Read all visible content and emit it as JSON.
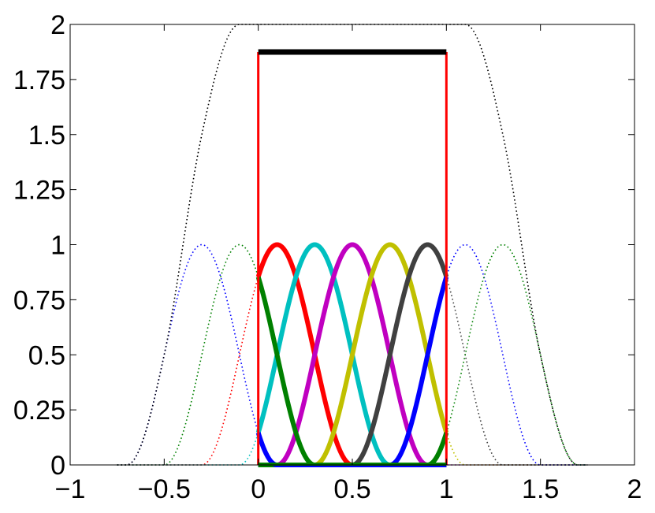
{
  "chart_data": {
    "type": "line",
    "title": "",
    "xlabel": "",
    "ylabel": "",
    "xlim": [
      -1,
      2
    ],
    "ylim": [
      0,
      2
    ],
    "grid": false,
    "legend": "none",
    "x_ticks": [
      -1,
      -0.5,
      0,
      0.5,
      1,
      1.5,
      2
    ],
    "x_tick_labels": [
      "−1",
      "−0.5",
      "0",
      "0.5",
      "1",
      "1.5",
      "2"
    ],
    "y_ticks": [
      0,
      0.25,
      0.5,
      0.75,
      1,
      1.25,
      1.5,
      1.75,
      2
    ],
    "y_tick_labels": [
      "0",
      "0.25",
      "0.5",
      "0.75",
      "1",
      "1.25",
      "1.5",
      "1.75",
      "2"
    ],
    "basis_width": 0.4,
    "series": [
      {
        "center": -0.3,
        "color": "#0000ff",
        "style": "dotted",
        "visible_range": [
          -0.75,
          1
        ]
      },
      {
        "center": -0.1,
        "color": "#008000",
        "style": "dotted",
        "visible_range": [
          -0.75,
          1
        ]
      },
      {
        "center": 0.1,
        "color": "#ff0000",
        "style": "dotted",
        "visible_range": [
          -0.75,
          1
        ]
      },
      {
        "center": 0.3,
        "color": "#00c0c0",
        "style": "dotted",
        "visible_range": [
          -0.75,
          1
        ]
      },
      {
        "center": 0.5,
        "color": "#c000c0",
        "style": "dotted",
        "visible_range": [
          0,
          1.75
        ]
      },
      {
        "center": 0.7,
        "color": "#c0c000",
        "style": "dotted",
        "visible_range": [
          0,
          1.75
        ]
      },
      {
        "center": 0.9,
        "color": "#404040",
        "style": "dotted",
        "visible_range": [
          0,
          1.75
        ]
      },
      {
        "center": 1.1,
        "color": "#0000ff",
        "style": "dotted",
        "visible_range": [
          0,
          1.75
        ]
      },
      {
        "center": 1.3,
        "color": "#008000",
        "style": "dotted",
        "visible_range": [
          0,
          1.75
        ]
      },
      {
        "center": 0.1,
        "color": "#ff0000",
        "style": "solid",
        "visible_range": [
          0,
          1
        ]
      },
      {
        "center": 0.3,
        "color": "#00c0c0",
        "style": "solid",
        "visible_range": [
          0,
          1
        ]
      },
      {
        "center": 0.5,
        "color": "#c000c0",
        "style": "solid",
        "visible_range": [
          0,
          1
        ]
      },
      {
        "center": 0.7,
        "color": "#c0c000",
        "style": "solid",
        "visible_range": [
          0,
          1
        ]
      },
      {
        "center": 0.9,
        "color": "#404040",
        "style": "solid",
        "visible_range": [
          0,
          1
        ]
      },
      {
        "center": 1.1,
        "color": "#0000ff",
        "style": "solid",
        "visible_range": [
          0,
          1
        ]
      },
      {
        "center": 1.3,
        "color": "#008000",
        "style": "solid",
        "visible_range": [
          0,
          1
        ]
      },
      {
        "center": -0.1,
        "color": "#008000",
        "style": "solid",
        "visible_range": [
          0,
          1
        ]
      },
      {
        "center": -0.3,
        "color": "#0000ff",
        "style": "solid",
        "visible_range": [
          0,
          1
        ]
      }
    ],
    "sum_curve": {
      "color": "#000000",
      "style": "dotted",
      "range": [
        -0.75,
        1.75
      ],
      "centers_from": -0.3,
      "centers_to": 1.3,
      "step": 0.2
    },
    "sum_segment": {
      "color": "#000000",
      "style": "solid",
      "x": [
        0,
        1
      ],
      "y": 1.875
    },
    "window": {
      "color": "#ff0000",
      "x": [
        0,
        1
      ],
      "y": [
        0,
        1.875
      ]
    }
  }
}
